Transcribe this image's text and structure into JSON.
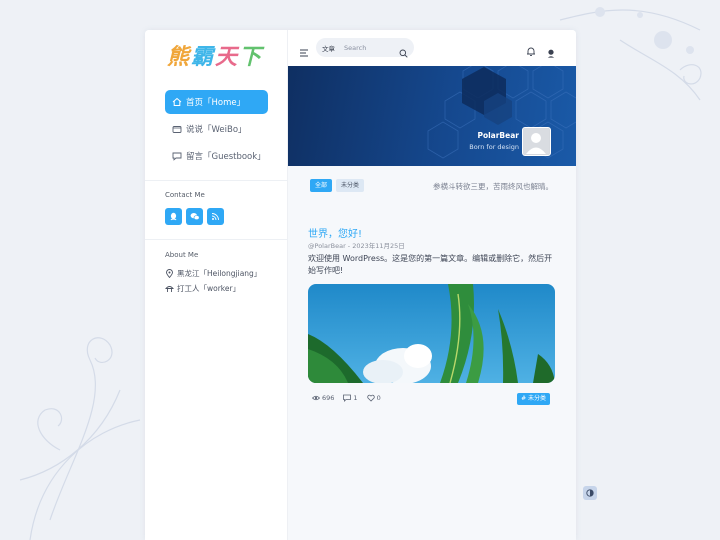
{
  "site": {
    "logo_chars": [
      "熊",
      "霸",
      "天",
      "下"
    ]
  },
  "sidebar": {
    "nav": [
      {
        "label": "首页「Home」",
        "icon": "home-icon",
        "active": true
      },
      {
        "label": "说说「WeiBo」",
        "icon": "folder-icon",
        "active": false
      },
      {
        "label": "留言「Guestbook」",
        "icon": "message-icon",
        "active": false
      }
    ],
    "contact_title": "Contact Me",
    "contact_icons": [
      "qq-icon",
      "wechat-icon",
      "rss-icon"
    ],
    "about_title": "About Me",
    "about": [
      {
        "icon": "location-icon",
        "text": "黑龙江「Heilongjiang」"
      },
      {
        "icon": "worker-icon",
        "text": "打工人「worker」"
      }
    ]
  },
  "topbar": {
    "search_scope": "文章",
    "search_placeholder": "Search"
  },
  "banner": {
    "name": "PolarBear",
    "subtitle": "Born for design"
  },
  "filters": [
    "全部",
    "未分类"
  ],
  "motto": "参横斗转欲三更，苦雨终风也解晴。",
  "post": {
    "title": "世界，您好!",
    "meta": "@PolarBear - 2023年11月25日",
    "excerpt": "欢迎使用 WordPress。这是您的第一篇文章。编辑或删除它，然后开始写作吧!",
    "views": "696",
    "comments": "1",
    "likes": "0",
    "category": "# 未分类"
  },
  "colors": {
    "accent": "#2fa8f5",
    "banner_dark": "#0f2f62",
    "page_bg": "#eef1f6"
  }
}
